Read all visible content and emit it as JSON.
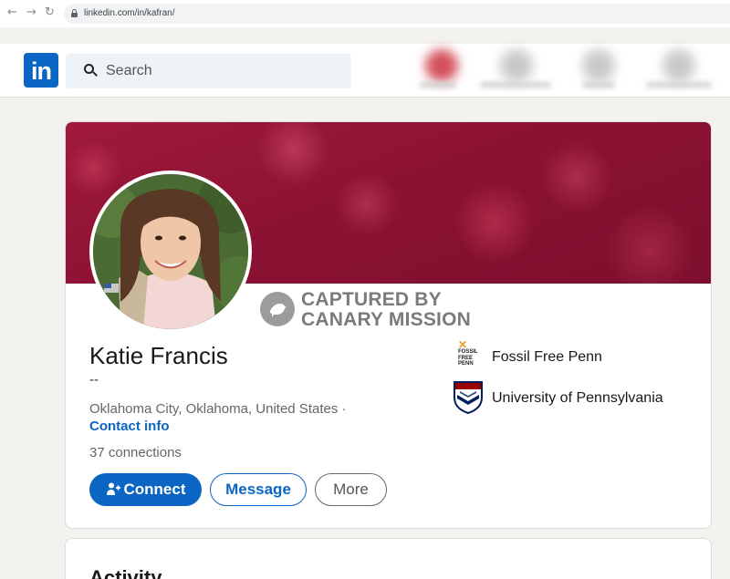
{
  "browser": {
    "back_icon": "←",
    "forward_icon": "→",
    "reload_icon": "↻",
    "url": "linkedin.com/in/kafran/"
  },
  "header": {
    "logo_text": "in",
    "search_placeholder": "Search"
  },
  "profile": {
    "name": "Katie Francis",
    "headline": "--",
    "location": "Oklahoma City, Oklahoma, United States ·",
    "contact_info": "Contact info",
    "connections": "37 connections"
  },
  "watermark": {
    "line1": "CAPTURED BY",
    "line2": "CANARY MISSION"
  },
  "actions": {
    "connect": "Connect",
    "message": "Message",
    "more": "More"
  },
  "organizations": [
    {
      "name": "Fossil Free Penn",
      "logo_text": [
        "FOSSIL",
        "FREE",
        "PENN"
      ]
    },
    {
      "name": "University of Pennsylvania"
    }
  ],
  "activity": {
    "title": "Activity"
  },
  "colors": {
    "brand": "#0a66c2",
    "banner": "#8c1233"
  }
}
